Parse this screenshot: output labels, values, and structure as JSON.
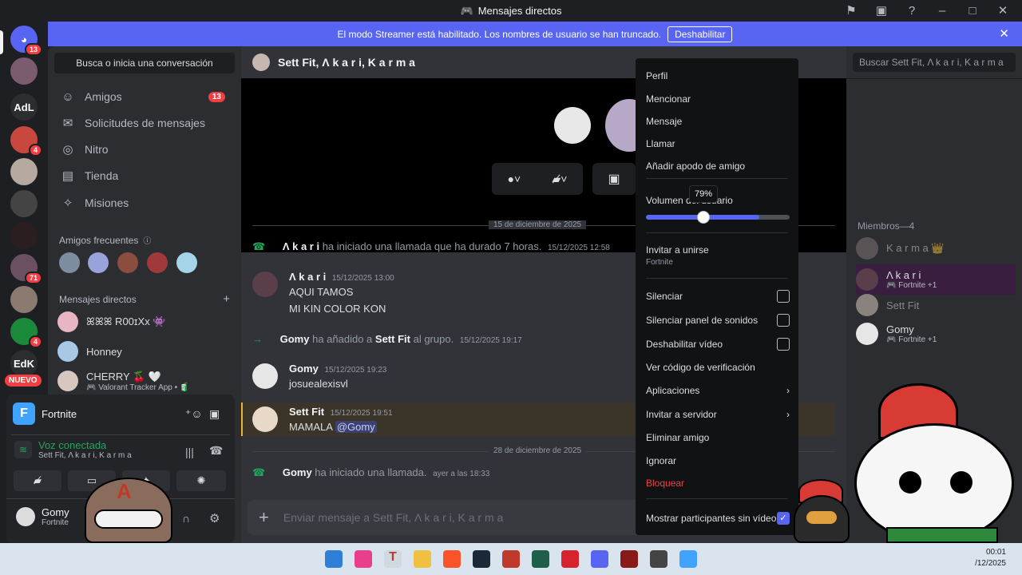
{
  "window": {
    "title": "Mensajes directos"
  },
  "banner": {
    "text": "El modo Streamer está habilitado. Los nombres de usuario se han truncado.",
    "button": "Deshabilitar"
  },
  "guilds": [
    {
      "label": "",
      "badge": "13"
    },
    {
      "label": "",
      "badge": ""
    },
    {
      "label": "AdL",
      "badge": ""
    },
    {
      "label": "",
      "badge": "4"
    },
    {
      "label": "",
      "badge": ""
    },
    {
      "label": "",
      "badge": ""
    },
    {
      "label": "",
      "badge": ""
    },
    {
      "label": "",
      "badge": "71"
    },
    {
      "label": "",
      "badge": ""
    },
    {
      "label": "",
      "badge": "4"
    },
    {
      "label": "EdK",
      "badge": ""
    }
  ],
  "guild_new": "NUEVO",
  "dm_sidebar": {
    "search": "Busca o inicia una conversación",
    "nav": [
      {
        "label": "Amigos",
        "badge": "13",
        "icon": "friends-icon"
      },
      {
        "label": "Solicitudes de mensajes",
        "badge": "",
        "icon": "mail-icon"
      },
      {
        "label": "Nitro",
        "badge": "",
        "icon": "nitro-icon"
      },
      {
        "label": "Tienda",
        "badge": "",
        "icon": "shop-icon"
      },
      {
        "label": "Misiones",
        "badge": "",
        "icon": "quest-icon"
      }
    ],
    "frequent_header": "Amigos frecuentes",
    "dm_header": "Mensajes directos",
    "dms": [
      {
        "name": "ꕤꕤꕤ R00ɪXx 👾",
        "sub": ""
      },
      {
        "name": "Honney",
        "sub": ""
      },
      {
        "name": "CHERRY 🍒 🤍",
        "sub": "🎮 Valorant Tracker App • 🧃"
      }
    ]
  },
  "voice_panel": {
    "activity": "Fortnite",
    "status": "Voz conectada",
    "channel": "Sett Fit, Λ k a r i, K a r m a",
    "user": "Gomy",
    "user_status": "Fortnite"
  },
  "chat": {
    "header": "Sett Fit, Λ k a r i, K a r m a",
    "messages": [
      {
        "type": "date",
        "text": "15 de diciembre de 2025"
      },
      {
        "type": "system",
        "name": "Λ k a r i",
        "text": "ha iniciado una llamada que ha durado 7 horas.",
        "ts": "15/12/2025 12:58"
      },
      {
        "type": "user",
        "name": "Λ k a r i",
        "ts": "15/12/2025 13:00",
        "lines": [
          "AQUI TAMOS",
          "MI KIN COLOR KON"
        ]
      },
      {
        "type": "system",
        "name": "Gomy",
        "text": "ha añadido a",
        "target": "Sett Fit",
        "text2": "al grupo.",
        "ts": "15/12/2025 19:17"
      },
      {
        "type": "user",
        "name": "Gomy",
        "ts": "15/12/2025 19:23",
        "lines": [
          "josuealexisvl"
        ]
      },
      {
        "type": "user",
        "name": "Sett Fit",
        "ts": "15/12/2025 19:51",
        "lines": [
          "MAMALA"
        ],
        "mention": "@Gomy"
      },
      {
        "type": "date",
        "text": "28 de diciembre de 2025"
      },
      {
        "type": "system",
        "name": "Gomy",
        "text": "ha iniciado una llamada.",
        "ts": "ayer a las 18:33"
      }
    ],
    "composer_placeholder": "Enviar mensaje a Sett Fit, Λ k a r i, K a r m a"
  },
  "members": {
    "search": "Buscar Sett Fit, Λ k a r i, K a r m a",
    "header": "Miembros—4",
    "list": [
      {
        "name": "K a r m a 👑",
        "sub": ""
      },
      {
        "name": "Λ k a r i",
        "sub": "🎮 Fortnite +1"
      },
      {
        "name": "Sett Fit",
        "sub": ""
      },
      {
        "name": "Gomy",
        "sub": "🎮 Fortnite +1"
      }
    ]
  },
  "context_menu": {
    "items": [
      "Perfil",
      "Mencionar",
      "Mensaje",
      "Llamar",
      "Añadir apodo de amigo"
    ],
    "volume_label": "Volumen del usuario",
    "volume_value": 0.79,
    "volume_tooltip": "79%",
    "invite": "Invitar a unirse",
    "invite_sub": "Fortnite",
    "checks": [
      "Silenciar",
      "Silenciar panel de sonidos",
      "Deshabilitar vídeo"
    ],
    "verify": "Ver código de verificación",
    "apps": "Aplicaciones",
    "invite_server": "Invitar a servidor",
    "remove": "Eliminar amigo",
    "ignore": "Ignorar",
    "block": "Bloquear",
    "show_participants": "Mostrar participantes sin vídeo"
  },
  "taskbar": {
    "time": "00:01",
    "date": "/12/2025"
  },
  "colors": {
    "blurple": "#5865f2",
    "danger": "#f23f43",
    "online": "#23a55a"
  }
}
